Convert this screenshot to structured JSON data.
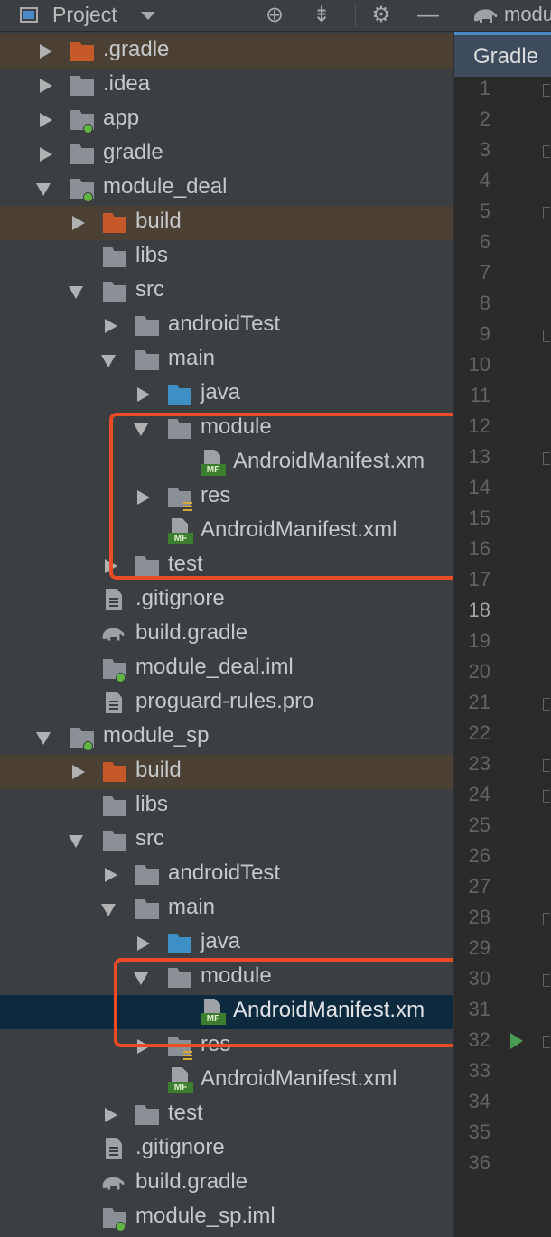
{
  "toolbar": {
    "title": "Project",
    "icons": [
      "view-icon",
      "caret-down-icon",
      "locate-icon",
      "collapse-all-icon",
      "gear-icon",
      "hide-icon"
    ]
  },
  "tree": [
    {
      "label": ".gradle",
      "depth": 0,
      "arrow": "right",
      "icon": "folder-orange",
      "highlight": "top"
    },
    {
      "label": ".idea",
      "depth": 0,
      "arrow": "right",
      "icon": "folder"
    },
    {
      "label": "app",
      "depth": 0,
      "arrow": "right",
      "icon": "module-folder"
    },
    {
      "label": "gradle",
      "depth": 0,
      "arrow": "right",
      "icon": "folder"
    },
    {
      "label": "module_deal",
      "depth": 0,
      "arrow": "down",
      "icon": "module-folder"
    },
    {
      "label": "build",
      "depth": 1,
      "arrow": "right",
      "icon": "folder-orange",
      "highlight": "build"
    },
    {
      "label": "libs",
      "depth": 1,
      "arrow": "none",
      "icon": "folder"
    },
    {
      "label": "src",
      "depth": 1,
      "arrow": "down",
      "icon": "folder"
    },
    {
      "label": "androidTest",
      "depth": 2,
      "arrow": "right",
      "icon": "folder"
    },
    {
      "label": "main",
      "depth": 2,
      "arrow": "down",
      "icon": "folder"
    },
    {
      "label": "java",
      "depth": 3,
      "arrow": "right",
      "icon": "folder-blue"
    },
    {
      "label": "module",
      "depth": 3,
      "arrow": "down",
      "icon": "folder"
    },
    {
      "label": "AndroidManifest.xm",
      "depth": 4,
      "arrow": "none",
      "icon": "manifest"
    },
    {
      "label": "res",
      "depth": 3,
      "arrow": "right",
      "icon": "res-folder"
    },
    {
      "label": "AndroidManifest.xml",
      "depth": 3,
      "arrow": "none",
      "icon": "manifest"
    },
    {
      "label": "test",
      "depth": 2,
      "arrow": "right",
      "icon": "folder"
    },
    {
      "label": ".gitignore",
      "depth": 1,
      "arrow": "none",
      "icon": "text-file"
    },
    {
      "label": "build.gradle",
      "depth": 1,
      "arrow": "none",
      "icon": "gradle-elephant"
    },
    {
      "label": "module_deal.iml",
      "depth": 1,
      "arrow": "none",
      "icon": "module-folder"
    },
    {
      "label": "proguard-rules.pro",
      "depth": 1,
      "arrow": "none",
      "icon": "text-file"
    },
    {
      "label": "module_sp",
      "depth": 0,
      "arrow": "down",
      "icon": "module-folder"
    },
    {
      "label": "build",
      "depth": 1,
      "arrow": "right",
      "icon": "folder-orange",
      "highlight": "build"
    },
    {
      "label": "libs",
      "depth": 1,
      "arrow": "none",
      "icon": "folder"
    },
    {
      "label": "src",
      "depth": 1,
      "arrow": "down",
      "icon": "folder"
    },
    {
      "label": "androidTest",
      "depth": 2,
      "arrow": "right",
      "icon": "folder"
    },
    {
      "label": "main",
      "depth": 2,
      "arrow": "down",
      "icon": "folder"
    },
    {
      "label": "java",
      "depth": 3,
      "arrow": "right",
      "icon": "folder-blue"
    },
    {
      "label": "module",
      "depth": 3,
      "arrow": "down",
      "icon": "folder"
    },
    {
      "label": "AndroidManifest.xm",
      "depth": 4,
      "arrow": "none",
      "icon": "manifest",
      "selected": true
    },
    {
      "label": "res",
      "depth": 3,
      "arrow": "right",
      "icon": "res-folder"
    },
    {
      "label": "AndroidManifest.xml",
      "depth": 3,
      "arrow": "none",
      "icon": "manifest"
    },
    {
      "label": "test",
      "depth": 2,
      "arrow": "right",
      "icon": "folder"
    },
    {
      "label": ".gitignore",
      "depth": 1,
      "arrow": "none",
      "icon": "text-file"
    },
    {
      "label": "build.gradle",
      "depth": 1,
      "arrow": "none",
      "icon": "gradle-elephant"
    },
    {
      "label": "module_sp.iml",
      "depth": 1,
      "arrow": "none",
      "icon": "module-folder"
    }
  ],
  "editor": {
    "tab_label": "modu",
    "panel_label": "Gradle",
    "line_numbers": [
      "1",
      "2",
      "3",
      "4",
      "5",
      "6",
      "7",
      "8",
      "9",
      "10",
      "11",
      "12",
      "13",
      "14",
      "15",
      "16",
      "17",
      "18",
      "19",
      "20",
      "21",
      "22",
      "23",
      "24",
      "25",
      "26",
      "27",
      "28",
      "29",
      "30",
      "31",
      "32",
      "33",
      "34",
      "35",
      "36"
    ],
    "current_line": "18",
    "run_marker_line": "32"
  },
  "colors": {
    "panel_bg": "#3c3f41",
    "editor_bg": "#2b2b2b",
    "selection": "#0d293e",
    "highlight_box": "#ec4b25",
    "manifest_green": "#3d7d2f"
  }
}
